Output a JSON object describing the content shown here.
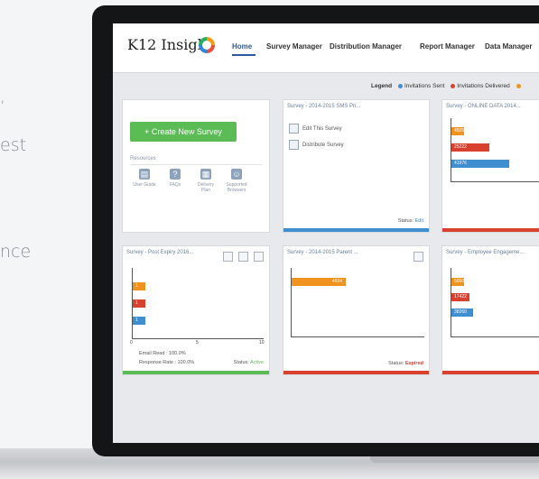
{
  "side_text": {
    "line1": ",",
    "line2": "est",
    "line3": "nce"
  },
  "app": {
    "logo_text": "K12 Insight"
  },
  "nav": {
    "items": [
      {
        "label": "Home"
      },
      {
        "label": "Survey Manager"
      },
      {
        "label": "Distribution Manager"
      },
      {
        "label": "Report Manager"
      },
      {
        "label": "Data Manager"
      }
    ]
  },
  "legend": {
    "title": "Legend",
    "items": [
      {
        "label": "Invitations Sent",
        "color": "#3f8ed0"
      },
      {
        "label": "Invitations Delivered",
        "color": "#d9412f"
      },
      {
        "label": "",
        "color": "#f0931e"
      }
    ]
  },
  "create_card": {
    "button_label": "+ Create New Survey",
    "resources_title": "Resources",
    "resources": [
      {
        "label": "User Guide",
        "icon": "book-icon"
      },
      {
        "label": "FAQs",
        "icon": "question-icon"
      },
      {
        "label": "Delivery Plan",
        "icon": "document-icon"
      },
      {
        "label": "Supported Browsers",
        "icon": "browser-icon"
      }
    ]
  },
  "cards": {
    "c2": {
      "title": "Survey - 2014-2015 SMS Pri...",
      "links": [
        "Edit This Survey",
        "Distribute Survey"
      ],
      "status_label": "Status:",
      "status_value": "Edit",
      "status_color": "#3f8ed0"
    },
    "c3": {
      "title": "Survey - ONLINE DATA 2014...",
      "bar_values": [
        "4505",
        "25222",
        "41976"
      ]
    },
    "c4": {
      "title": "Survey - Post Expiry 2016...",
      "bar_values": [
        "1",
        "1",
        "1"
      ],
      "axis_ticks": [
        "0",
        "5",
        "10"
      ],
      "email_read": "Email Read : 100.0%",
      "response_rate": "Response Rate : 100.0%",
      "status_label": "Status:",
      "status_value": "Active",
      "status_color": "#5bbb55"
    },
    "c5": {
      "title": "Survey - 2014-2015 Parent ...",
      "bar_values": [
        "4694"
      ],
      "status_label": "Status:",
      "status_value": "Expired",
      "status_color": "#d9412f"
    },
    "c6": {
      "title": "Survey - Employee Engageme...",
      "bar_values": [
        "5050",
        "17422",
        "38260"
      ]
    }
  },
  "chart_data": [
    {
      "type": "bar",
      "title": "Survey - ONLINE DATA 2014...",
      "series": [
        {
          "name": "Invitations Sent",
          "values": [
            41976
          ]
        },
        {
          "name": "Invitations Delivered",
          "values": [
            25222
          ]
        },
        {
          "values": [
            4505
          ]
        }
      ]
    },
    {
      "type": "bar",
      "title": "Survey - Post Expiry 2016...",
      "categories": [
        "",
        "",
        ""
      ],
      "values": [
        1,
        1,
        1
      ],
      "xlim": [
        0,
        10
      ]
    },
    {
      "type": "bar",
      "title": "Survey - 2014-2015 Parent ...",
      "values": [
        4694
      ]
    },
    {
      "type": "bar",
      "title": "Survey - Employee Engageme...",
      "series": [
        {
          "name": "Invitations Sent",
          "values": [
            38260
          ]
        },
        {
          "name": "Invitations Delivered",
          "values": [
            17422
          ]
        },
        {
          "values": [
            5050
          ]
        }
      ]
    }
  ]
}
